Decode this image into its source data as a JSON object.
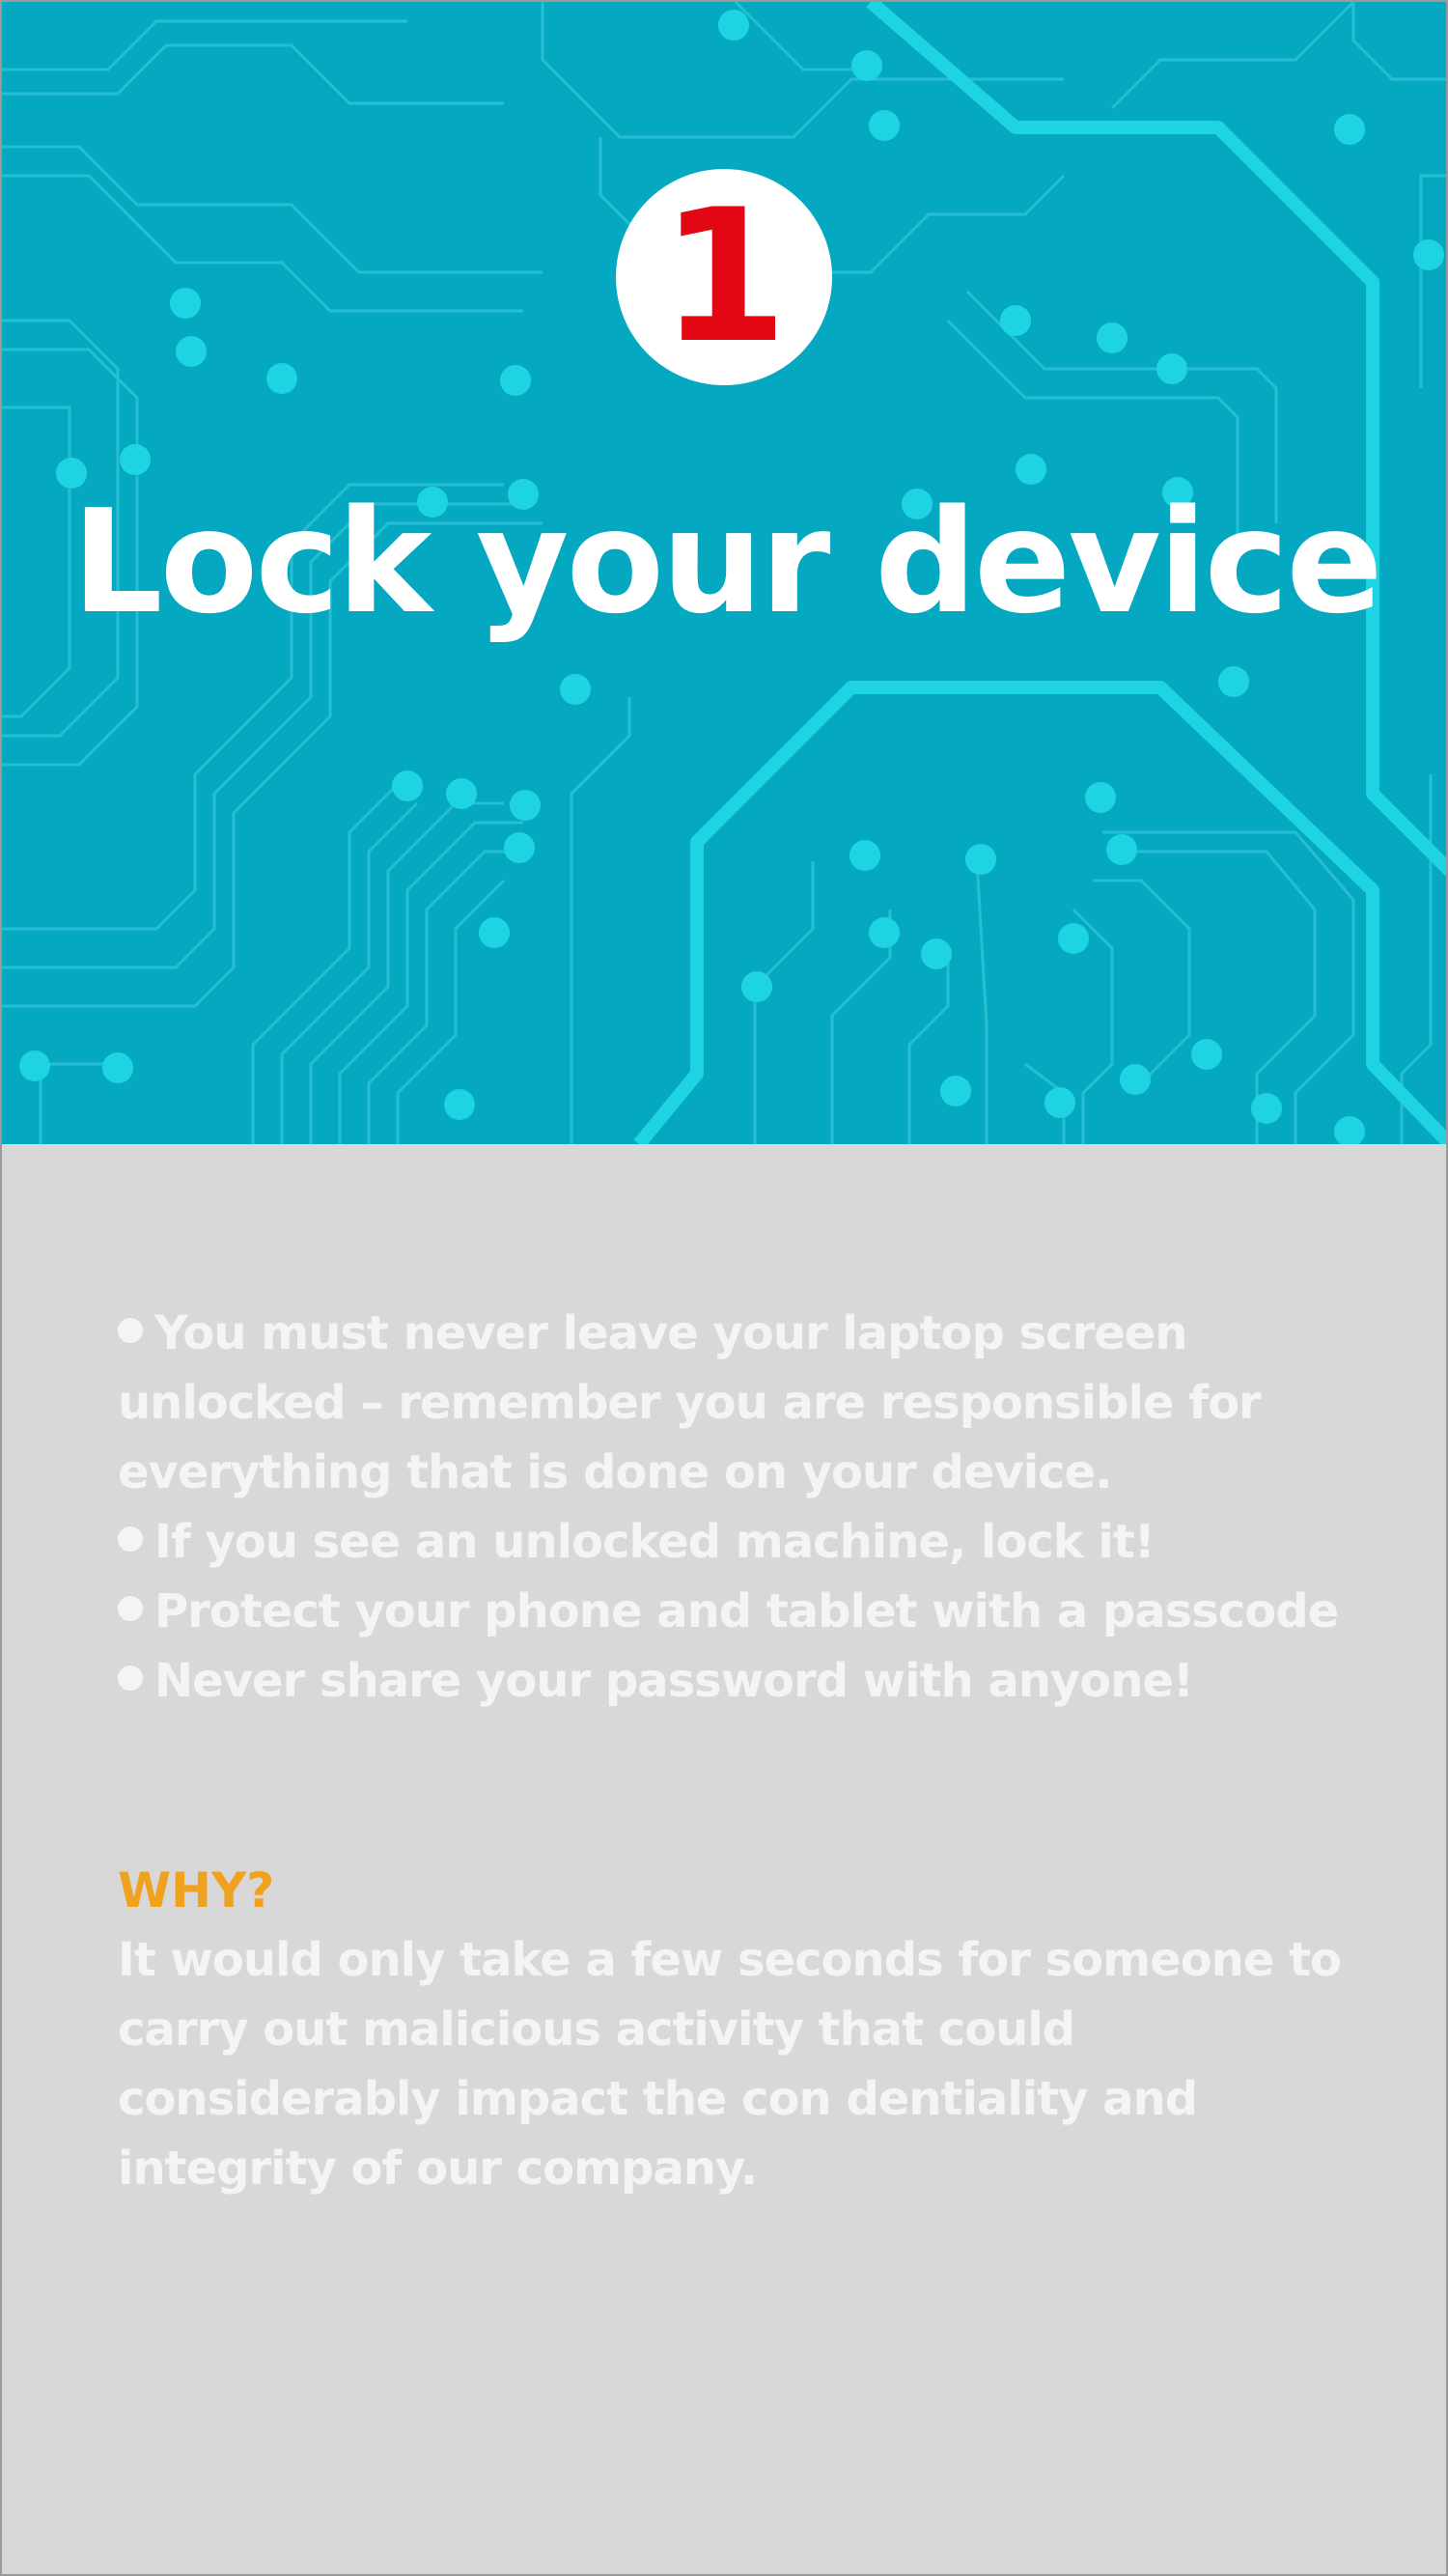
{
  "hero": {
    "badge_number": "1",
    "title": "Lock your device"
  },
  "bullets": [
    {
      "lines": [
        "You must never leave your laptop screen",
        "unlocked – remember you are responsible for",
        "everything that is done on your device."
      ]
    },
    {
      "lines": [
        "If you see an unlocked machine, lock it!"
      ]
    },
    {
      "lines": [
        "Protect your phone and tablet with a passcode"
      ]
    },
    {
      "lines": [
        "Never share your password with anyone!"
      ]
    }
  ],
  "why": {
    "heading": "WHY?",
    "lines": [
      "It would only take a few seconds for someone to",
      "carry out malicious activity that could",
      "considerably impact the con dentiality and",
      "integrity of our company."
    ]
  },
  "colors": {
    "hero_background": "#04a9c1",
    "circuit_trace": "#2cc3d6",
    "circuit_node": "#1fd4e2",
    "badge_number": "#e30613",
    "page_background": "#d8d8d8",
    "body_text": "#f4f4f4",
    "why_heading": "#f0a21f"
  },
  "icons": {
    "hero_pattern": "circuit-board-pattern",
    "bullet": "bullet-dot"
  }
}
